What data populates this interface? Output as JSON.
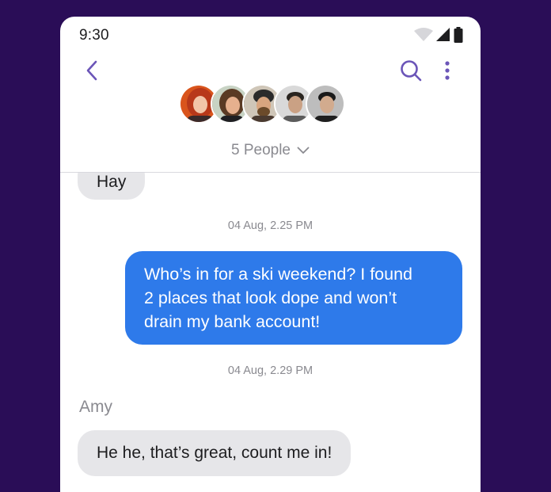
{
  "status_bar": {
    "time": "9:30"
  },
  "header": {
    "people_label": "5 People",
    "icons": {
      "back": "chevron-left-icon",
      "search": "search-icon",
      "more": "more-vertical-icon",
      "toggle": "chevron-down-icon"
    },
    "accent_color": "#6b55b8"
  },
  "messages": [
    {
      "type": "incoming",
      "text": "Hay"
    },
    {
      "type": "timestamp",
      "text": "04 Aug, 2.25 PM"
    },
    {
      "type": "outgoing",
      "lines": [
        "Who’s in for a ski weekend? I found",
        "2 places that look dope and won’t",
        "drain my bank account!"
      ]
    },
    {
      "type": "timestamp",
      "text": "04 Aug, 2.29 PM"
    },
    {
      "type": "sender",
      "text": "Amy"
    },
    {
      "type": "incoming",
      "text": "He he, that’s great, count me in!"
    }
  ],
  "colors": {
    "background": "#2a0d57",
    "outgoing_bubble": "#2e7aea",
    "incoming_bubble": "#e6e6e9"
  }
}
